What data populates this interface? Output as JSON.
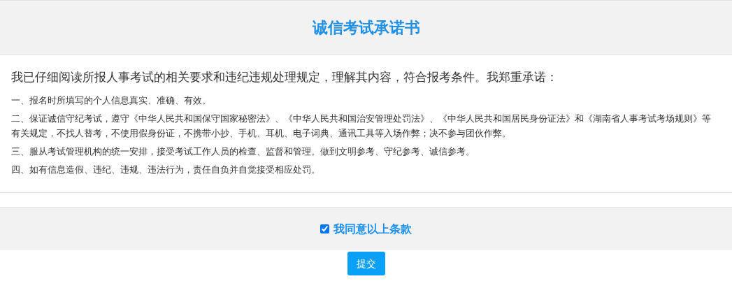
{
  "title": "诚信考试承诺书",
  "intro": "我已仔细阅读所报人事考试的相关要求和违纪违规处理规定，理解其内容，符合报考条件。我郑重承诺：",
  "items": [
    "一、报名时所填写的个人信息真实、准确、有效。",
    "二、保证诚信守纪考试，遵守《中华人民共和国保守国家秘密法》、《中华人民共和国治安管理处罚法》、《中华人民共和国居民身份证法》和《湖南省人事考试考场规则》等有关规定，不找人替考，不使用假身份证，不携带小抄、手机、耳机、电子词典、通讯工具等入场作弊；决不参与团伙作弊。",
    "三、服从考试管理机构的统一安排，接受考试工作人员的检查、监督和管理。做到文明参考、守纪参考、诚信参考。",
    "四、如有信息造假、违纪、违规、违法行为，责任自负并自觉接受相应处罚。"
  ],
  "agree": {
    "label": "我同意以上条款",
    "checked": true
  },
  "submit": "提交"
}
